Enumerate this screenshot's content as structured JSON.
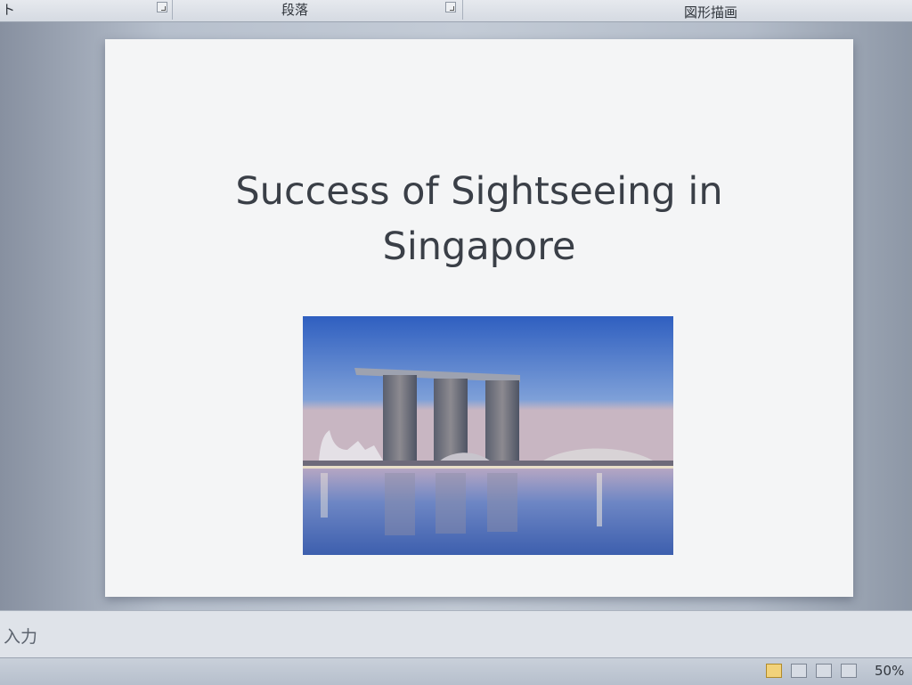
{
  "ribbon": {
    "group_font_fragment": "ト",
    "group_paragraph": "段落",
    "group_drawing": "図形描画"
  },
  "slide": {
    "title": "Success of Sightseeing in Singapore",
    "image_subject": "Marina Bay Sands skyline with reflection"
  },
  "notes": {
    "placeholder": "入力"
  },
  "status_bar": {
    "view_buttons": [
      "normal-view",
      "slide-sorter-view",
      "reading-view",
      "slide-show-view"
    ],
    "zoom": "50%"
  },
  "colors": {
    "workspace": "#b7c0cd",
    "slide_background": "#f4f5f6",
    "title_text": "#3a3f47",
    "sky_top": "#2f5fc0",
    "water": "#4a6fb5"
  }
}
